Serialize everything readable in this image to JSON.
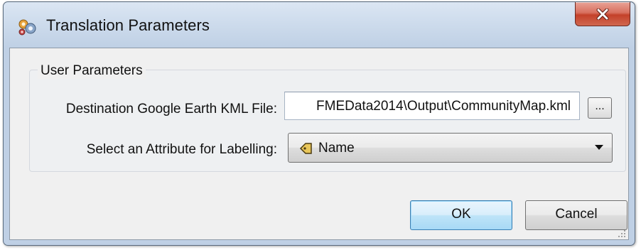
{
  "window": {
    "title": "Translation Parameters",
    "icons": {
      "app": "fme-workbench-app-icon",
      "close": "close-icon"
    }
  },
  "group": {
    "title": "User Parameters"
  },
  "destination": {
    "label": "Destination Google Earth KML File:",
    "value": "FMEData2014\\Output\\CommunityMap.kml",
    "browse_label": "..."
  },
  "attribute": {
    "label": "Select an Attribute for Labelling:",
    "selected": "Name",
    "icon": "attribute-tag-icon"
  },
  "buttons": {
    "ok": "OK",
    "cancel": "Cancel"
  },
  "colors": {
    "close_button": "#c4412a",
    "ok_button": "#bee4f8",
    "client_background": "#f0f0f0"
  }
}
